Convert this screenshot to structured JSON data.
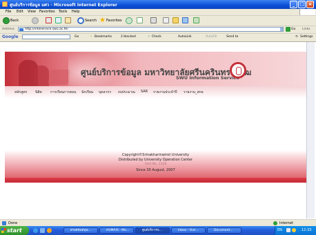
{
  "window": {
    "title": "ศูนย์บริการข้อมูล มศว - Microsoft Internet Explorer",
    "controls": [
      "_",
      "□",
      "×"
    ]
  },
  "menu": [
    "File",
    "Edit",
    "View",
    "Favorites",
    "Tools",
    "Help"
  ],
  "toolbar": {
    "back_label": "Back",
    "search_label": "Search",
    "favorites_label": "Favorites"
  },
  "address": {
    "label": "Address",
    "url": "http://infoservice.swu.ac.th/",
    "go_label": "Go",
    "links_label": "Links"
  },
  "google_toolbar": {
    "brand": "Google",
    "go_label": "Go",
    "bookmarks_label": "Bookmarks",
    "blocked_label": "2 blocked",
    "check_label": "Check",
    "autolink_label": "AutoLink",
    "autofill_label": "AutoFill",
    "sendto_label": "Send to",
    "settings_label": "Settings"
  },
  "site": {
    "title_thai": "ศูนย์บริการข้อมูล  มหาวิทยาลัยศรีนครินทรวิโรฒ",
    "subtitle": "SWU Information Service",
    "nav": [
      "หลักสูตร",
      "นิสิต",
      "การเรียนการสอน",
      "นักเรียน",
      "บุคลากร",
      "งบประมาณ",
      "SAR",
      "รายงานประจำปี",
      "รายงาน_สกอ"
    ],
    "footer": {
      "copyright": "Copyright©Srinakharinwirot University",
      "distributed": "Distributed by University Operation Center",
      "counter": "Visit No. 1328",
      "since": "Since 30 August, 2007"
    }
  },
  "status": {
    "left": "Done",
    "zone": "Internet"
  },
  "taskbar": {
    "start_label": "start",
    "tasks": [
      "ฝ่ายสนับสนุน...",
      "HUMAIS - Mo...",
      "ศูนย์บริการข...",
      "Inbox - Out...",
      "Document..."
    ],
    "tray_lang": "EN",
    "clock": "12:33"
  },
  "colors": {
    "banner_red": "#c4303a",
    "banner_pink": "#f4c6ca",
    "title_blue": "#0a4fd6",
    "taskbar_blue": "#245edb",
    "start_green": "#2d8f2a"
  }
}
